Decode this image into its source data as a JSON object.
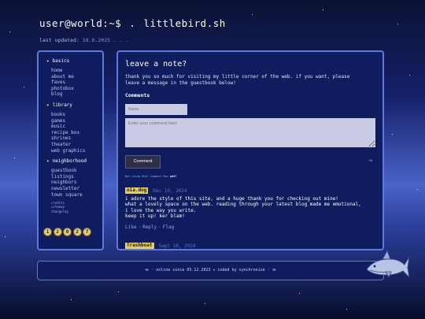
{
  "header": {
    "prompt": "user@world:~$",
    "dot": ".",
    "site": "littlebird.sh",
    "updated_label": "last updated:",
    "updated_date": "18.6.2025 . . ."
  },
  "sidebar": {
    "sections": [
      {
        "title": "basics",
        "items": [
          "home",
          "about me",
          "faves",
          "photobox",
          "blog"
        ]
      },
      {
        "title": "library",
        "items": [
          "books",
          "games",
          "music",
          "recipe box",
          "shrines",
          "theater",
          "web graphics"
        ]
      },
      {
        "title": "neighborhood",
        "items": [
          "guestbook",
          "listings",
          "neighbors",
          "newsletter",
          "town square"
        ]
      }
    ],
    "small_links": [
      "credits",
      "sitemap",
      "changelog"
    ],
    "badges": [
      "1",
      "2",
      "0",
      "2",
      "7"
    ]
  },
  "main": {
    "title": "leave a note?",
    "intro": "thank you so much for visiting my little corner of the web. if you want, please leave a message in the guestbook below!",
    "comments_heading": "Comments",
    "name_placeholder": "Name",
    "comment_placeholder": "Enter your comment here",
    "comment_button": "Comment",
    "powered_prefix": "Not using Html Comment Box",
    "powered_link": "yet?",
    "comments": [
      {
        "author": "nia.dog",
        "date": "Dec 19, 2024",
        "lines": [
          "i adore the style of this site, and a huge thank you for checking out mine!",
          "what a lovely space on the web. reading through your latest blog made me emotional,",
          "i love the way you write.",
          "keep it up! ker blam!"
        ],
        "actions": [
          "Like",
          "Reply",
          "Flag"
        ]
      },
      {
        "author": "Trashboat",
        "date": "Sept 18, 2024"
      }
    ]
  },
  "footer": {
    "text": "≪ · online since 05.12.2023 ✦ coded by synchronise · ≫"
  },
  "colors": {
    "accent": "#5f78db",
    "panel": "#0f1c5e",
    "author_tag": "#e6cd5c"
  }
}
